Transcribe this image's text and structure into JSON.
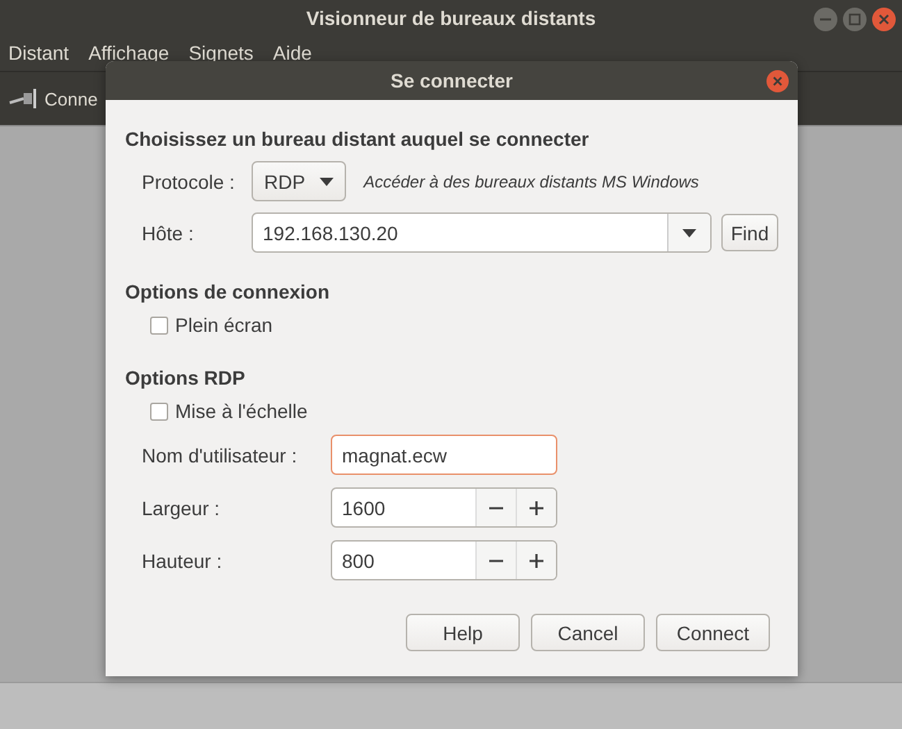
{
  "window": {
    "title": "Visionneur de bureaux distants"
  },
  "menu": [
    "Distant",
    "Affichage",
    "Signets",
    "Aide"
  ],
  "toolbar": [
    {
      "label": "Conne"
    }
  ],
  "dialog": {
    "title": "Se connecter",
    "heading": "Choisissez un bureau distant auquel se connecter",
    "protocol": {
      "label": "Protocole :",
      "value": "RDP",
      "description": "Accéder à des bureaux distants MS Windows"
    },
    "host": {
      "label": "Hôte :",
      "value": "192.168.130.20",
      "button": "Find"
    },
    "connection_options": {
      "heading": "Options de connexion",
      "checkboxes": [
        {
          "label": "Plein écran",
          "checked": false
        }
      ]
    },
    "rdp_options": {
      "heading": "Options RDP",
      "checkboxes": [
        {
          "label": "Mise à l'échelle",
          "checked": false
        }
      ],
      "fields": [
        {
          "kind": "text",
          "label": "Nom d'utilisateur :",
          "value": "magnat.ecw",
          "focused": true
        },
        {
          "kind": "spin",
          "label": "Largeur :",
          "value": "1600",
          "focused": false
        },
        {
          "kind": "spin",
          "label": "Hauteur :",
          "value": "800",
          "focused": false
        }
      ]
    },
    "buttons": [
      "Help",
      "Cancel",
      "Connect"
    ]
  }
}
